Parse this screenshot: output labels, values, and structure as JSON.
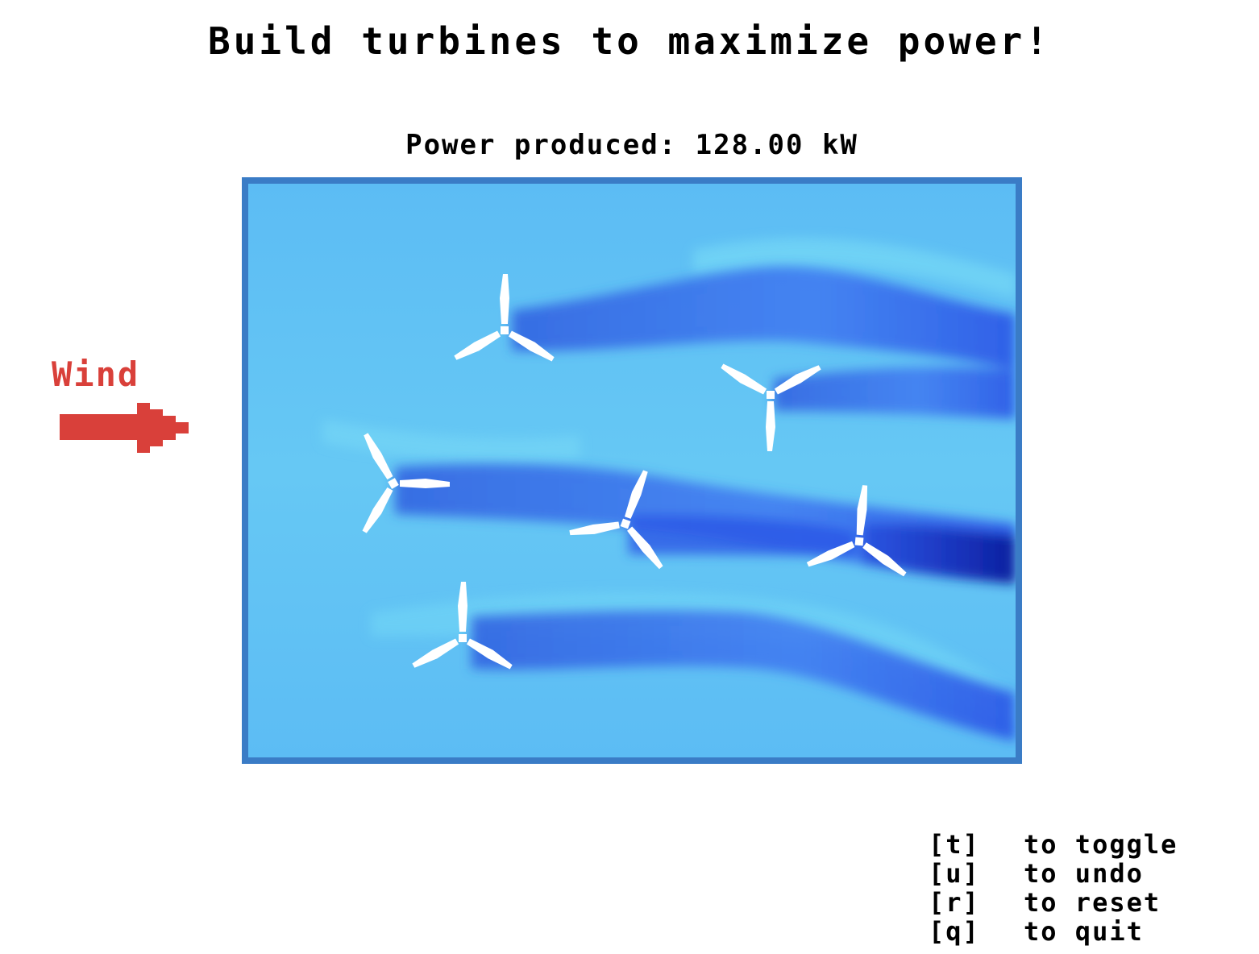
{
  "title": "Build turbines to maximize power!",
  "power": {
    "label": "Power produced:",
    "value": "128.00",
    "unit": "kW"
  },
  "wind": {
    "label": "Wind",
    "color": "#d9403a"
  },
  "field": {
    "border_color": "#3a7cc6",
    "flow_color": "#63c6f2",
    "wake_color": "#2f5fe0",
    "turbine_color": "#ffffff"
  },
  "turbines": [
    {
      "name": "turbine-1"
    },
    {
      "name": "turbine-2"
    },
    {
      "name": "turbine-3"
    },
    {
      "name": "turbine-4"
    },
    {
      "name": "turbine-5"
    },
    {
      "name": "turbine-6"
    }
  ],
  "controls": [
    {
      "key": "[t]",
      "text": "to toggle"
    },
    {
      "key": "[u]",
      "text": "to undo"
    },
    {
      "key": "[r]",
      "text": "to reset"
    },
    {
      "key": "[q]",
      "text": "to quit"
    }
  ]
}
